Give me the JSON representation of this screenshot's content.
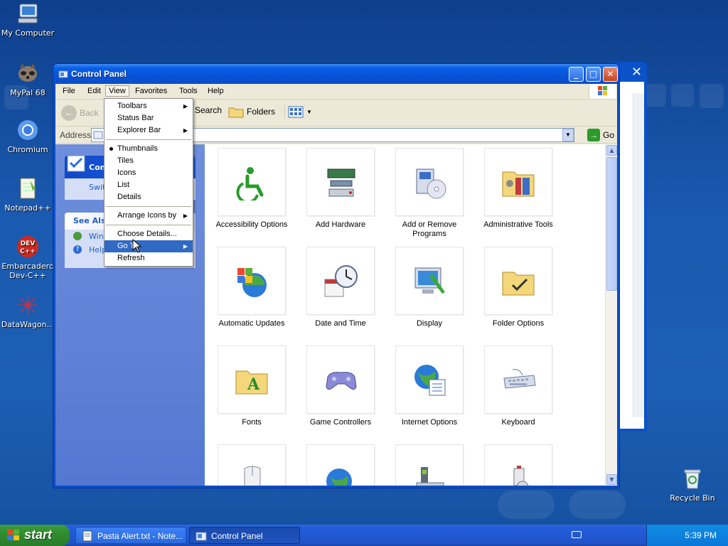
{
  "desktop": {
    "icons": [
      {
        "label": "My Computer",
        "icon": "my-computer-icon"
      },
      {
        "label": "MyPal 68",
        "icon": "mypal-icon"
      },
      {
        "label": "Chromium",
        "icon": "chromium-icon"
      },
      {
        "label": "Notepad++",
        "icon": "notepad-plus-plus-icon"
      },
      {
        "label": "Embarcadero Dev-C++",
        "icon": "devcpp-icon"
      },
      {
        "label": "DataWagon...",
        "icon": "datawagon-icon"
      },
      {
        "label": "Recycle Bin",
        "icon": "recycle-bin-icon"
      }
    ]
  },
  "window": {
    "title": "Control Panel",
    "controls": {
      "minimize": "_",
      "maximize": "□",
      "close": "✕"
    }
  },
  "menubar": [
    "File",
    "Edit",
    "View",
    "Favorites",
    "Tools",
    "Help"
  ],
  "toolbar": {
    "back": "Back",
    "search": "Search",
    "folders": "Folders"
  },
  "address": {
    "label": "Address",
    "go": "Go"
  },
  "left_pane": {
    "panel1_title": "Con",
    "panel1_item": "Swit",
    "panel2_title": "See Als",
    "panel2_items": [
      "Wind",
      "Help"
    ]
  },
  "view_menu": {
    "items": [
      {
        "label": "Toolbars",
        "submenu": true
      },
      {
        "label": "Status Bar"
      },
      {
        "label": "Explorer Bar",
        "submenu": true
      },
      {
        "separator": true
      },
      {
        "label": "Thumbnails",
        "checked": true
      },
      {
        "label": "Tiles"
      },
      {
        "label": "Icons"
      },
      {
        "label": "List"
      },
      {
        "label": "Details"
      },
      {
        "separator": true
      },
      {
        "label": "Arrange Icons by",
        "submenu": true
      },
      {
        "separator": true
      },
      {
        "label": "Choose Details..."
      },
      {
        "label": "Go To",
        "submenu": true,
        "highlighted": true
      },
      {
        "label": "Refresh"
      }
    ]
  },
  "control_panel_items": [
    {
      "label": "Accessibility Options",
      "icon": "accessibility-icon"
    },
    {
      "label": "Add Hardware",
      "icon": "add-hardware-icon"
    },
    {
      "label": "Add or Remove Programs",
      "icon": "add-remove-programs-icon"
    },
    {
      "label": "Administrative Tools",
      "icon": "administrative-tools-icon"
    },
    {
      "label": "Automatic Updates",
      "icon": "automatic-updates-icon"
    },
    {
      "label": "Date and Time",
      "icon": "date-time-icon"
    },
    {
      "label": "Display",
      "icon": "display-icon"
    },
    {
      "label": "Folder Options",
      "icon": "folder-options-icon"
    },
    {
      "label": "Fonts",
      "icon": "fonts-icon"
    },
    {
      "label": "Game Controllers",
      "icon": "game-controllers-icon"
    },
    {
      "label": "Internet Options",
      "icon": "internet-options-icon"
    },
    {
      "label": "Keyboard",
      "icon": "keyboard-icon"
    },
    {
      "label": "",
      "icon": "mouse-icon"
    },
    {
      "label": "",
      "icon": "network-icon"
    },
    {
      "label": "",
      "icon": "phone-modem-icon"
    },
    {
      "label": "",
      "icon": "power-options-icon"
    }
  ],
  "taskbar": {
    "start": "start",
    "tasks": [
      {
        "label": "Pasta Alert.txt - Note...",
        "active": false
      },
      {
        "label": "Control Panel",
        "active": true
      }
    ],
    "clock": "5:39 PM"
  },
  "colors": {
    "xp_blue": "#0a4fc7",
    "menu_highlight": "#316ac5",
    "start_green": "#2e8a2e"
  }
}
